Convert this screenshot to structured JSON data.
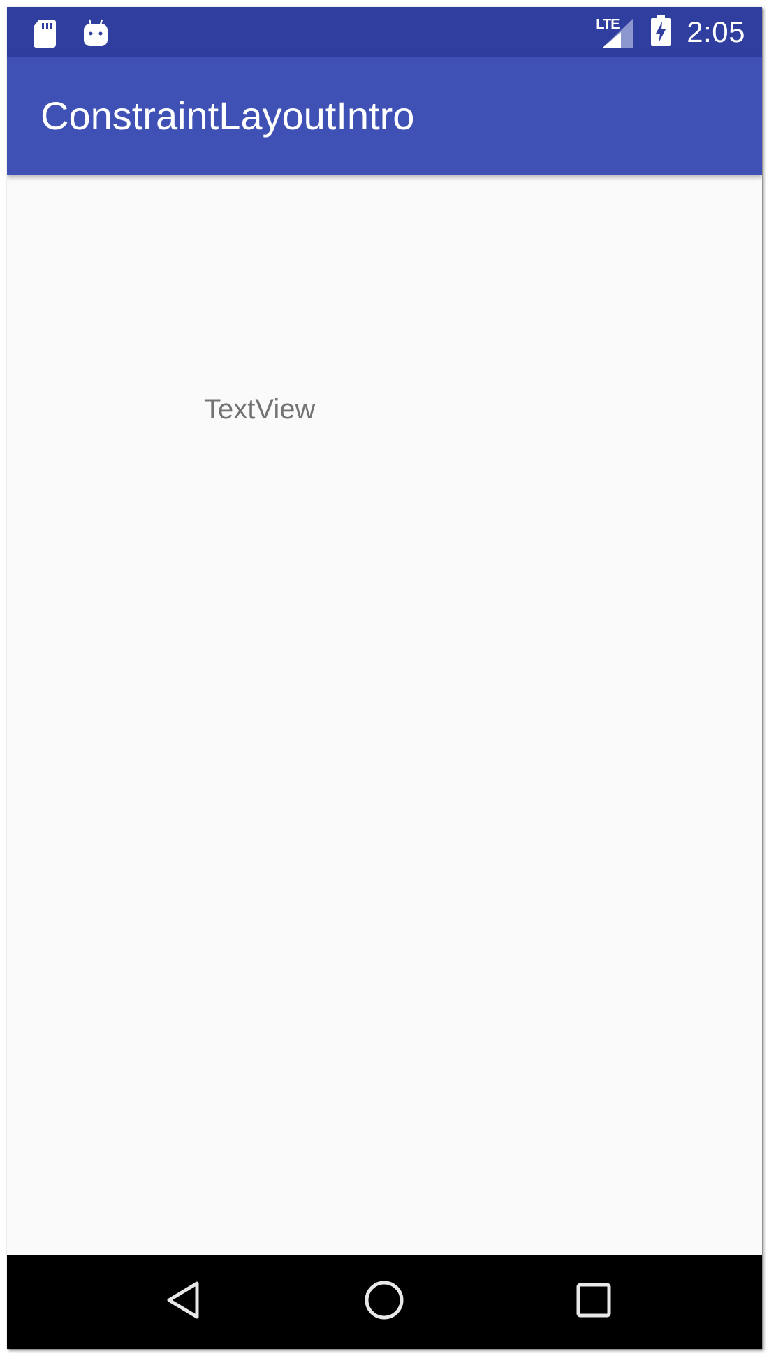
{
  "status_bar": {
    "time": "2:05",
    "network_label": "LTE",
    "icons": [
      "sd-card-icon",
      "android-debug-icon",
      "lte-signal-icon",
      "battery-charging-icon"
    ],
    "background": "#303f9f"
  },
  "app_bar": {
    "title": "ConstraintLayoutIntro",
    "background": "#3f51b5"
  },
  "content": {
    "text_view": "TextView",
    "background": "#fafafa"
  },
  "nav_bar": {
    "buttons": [
      "back-icon",
      "home-icon",
      "recents-icon"
    ]
  }
}
